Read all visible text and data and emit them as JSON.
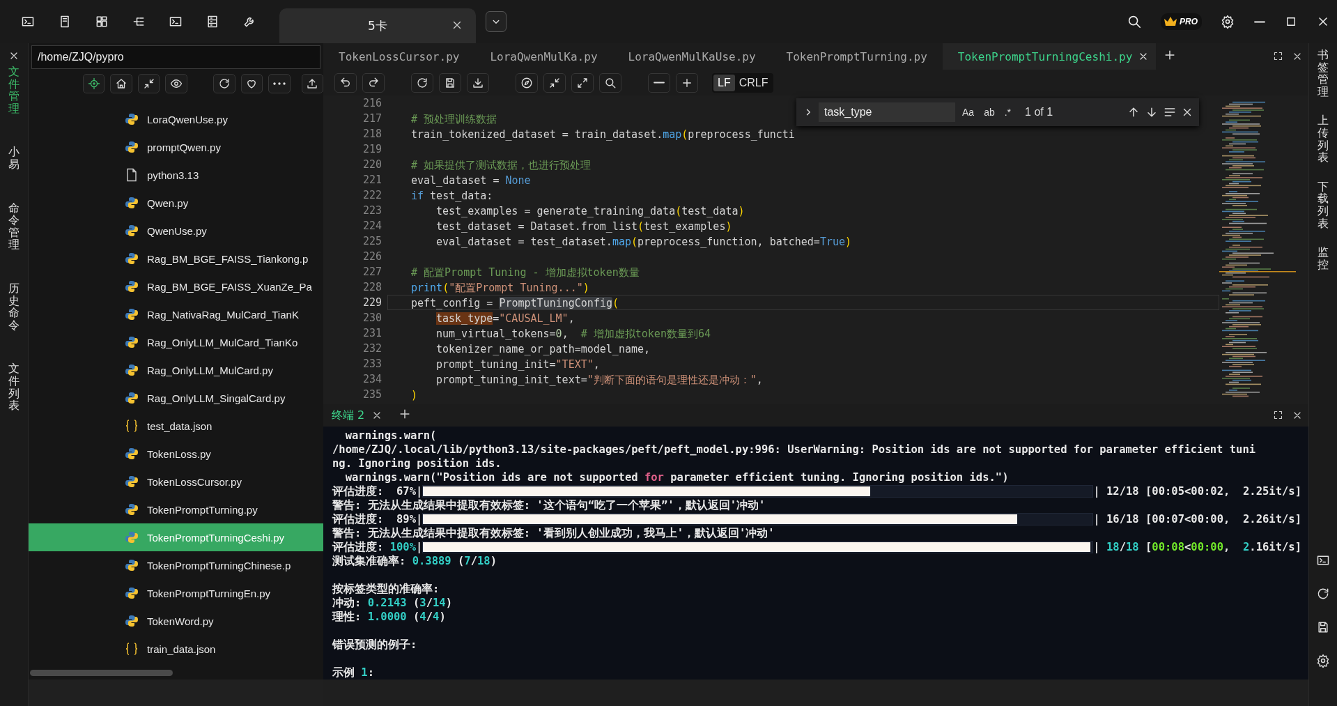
{
  "title_bar": {
    "tab": "5卡",
    "badge": "PRO"
  },
  "left_rail": {
    "items": [
      {
        "label": "文件管理",
        "selected": true
      },
      {
        "label": "小易",
        "selected": false
      },
      {
        "label": "命令管理",
        "selected": false
      },
      {
        "label": "历史命令",
        "selected": false
      },
      {
        "label": "文件列表",
        "selected": false
      }
    ]
  },
  "file_panel": {
    "path": "/home/ZJQ/pypro",
    "files": [
      {
        "name": "LoraQwenUse.py",
        "kind": "python",
        "selected": false
      },
      {
        "name": "promptQwen.py",
        "kind": "python",
        "selected": false
      },
      {
        "name": "python3.13",
        "kind": "file",
        "selected": false
      },
      {
        "name": "Qwen.py",
        "kind": "python",
        "selected": false
      },
      {
        "name": "QwenUse.py",
        "kind": "python",
        "selected": false
      },
      {
        "name": "Rag_BM_BGE_FAISS_Tiankong.p",
        "kind": "python",
        "selected": false
      },
      {
        "name": "Rag_BM_BGE_FAISS_XuanZe_Pa",
        "kind": "python",
        "selected": false
      },
      {
        "name": "Rag_NativaRag_MulCard_TianK",
        "kind": "python",
        "selected": false
      },
      {
        "name": "Rag_OnlyLLM_MulCard_TianKo",
        "kind": "python",
        "selected": false
      },
      {
        "name": "Rag_OnlyLLM_MulCard.py",
        "kind": "python",
        "selected": false
      },
      {
        "name": "Rag_OnlyLLM_SingalCard.py",
        "kind": "python",
        "selected": false
      },
      {
        "name": "test_data.json",
        "kind": "json",
        "selected": false
      },
      {
        "name": "TokenLoss.py",
        "kind": "python",
        "selected": false
      },
      {
        "name": "TokenLossCursor.py",
        "kind": "python",
        "selected": false
      },
      {
        "name": "TokenPromptTurning.py",
        "kind": "python",
        "selected": false
      },
      {
        "name": "TokenPromptTurningCeshi.py",
        "kind": "python",
        "selected": true
      },
      {
        "name": "TokenPromptTurningChinese.p",
        "kind": "python",
        "selected": false
      },
      {
        "name": "TokenPromptTurningEn.py",
        "kind": "python",
        "selected": false
      },
      {
        "name": "TokenWord.py",
        "kind": "python",
        "selected": false
      },
      {
        "name": "train_data.json",
        "kind": "json",
        "selected": false
      }
    ]
  },
  "editor": {
    "tabs": [
      {
        "label": "TokenLossCursor.py",
        "selected": false
      },
      {
        "label": "LoraQwenMulKa.py",
        "selected": false
      },
      {
        "label": "LoraQwenMulKaUse.py",
        "selected": false
      },
      {
        "label": "TokenPromptTurning.py",
        "selected": false
      },
      {
        "label": "TokenPromptTurningCeshi.py",
        "selected": true
      }
    ],
    "line_endings": [
      {
        "label": "LF",
        "selected": true
      },
      {
        "label": "CRLF",
        "selected": false
      }
    ],
    "find": {
      "value": "task_type",
      "options": [
        {
          "label": "Aa",
          "selected": false
        },
        {
          "label": "ab",
          "selected": false
        },
        {
          "label": ".*",
          "selected": false
        }
      ],
      "count": "1 of 1"
    },
    "lines": [
      {
        "number": "216",
        "current": false
      },
      {
        "number": "217",
        "current": false,
        "segments": [
          {
            "text": "# 预处理训练数据",
            "kind": "comment"
          }
        ]
      },
      {
        "number": "218",
        "current": false,
        "segments": [
          {
            "text": "train_tokenized_dataset = train_dataset.",
            "kind": "plain"
          },
          {
            "text": "map",
            "kind": "func"
          },
          {
            "text": "(",
            "kind": "paren"
          },
          {
            "text": "preprocess_functi",
            "kind": "plain"
          }
        ]
      },
      {
        "number": "219",
        "current": false
      },
      {
        "number": "220",
        "current": false,
        "segments": [
          {
            "text": "# 如果提供了测试数据，也进行预处理",
            "kind": "comment"
          }
        ]
      },
      {
        "number": "221",
        "current": false,
        "segments": [
          {
            "text": "eval_dataset = ",
            "kind": "plain"
          },
          {
            "text": "None",
            "kind": "keyword"
          }
        ]
      },
      {
        "number": "222",
        "current": false,
        "segments": [
          {
            "text": "if",
            "kind": "keyword"
          },
          {
            "text": " test_data:",
            "kind": "plain"
          }
        ],
        "children": [
          {
            "number": "223",
            "current": false,
            "segments": [
              {
                "text": "test_examples = generate_training_data",
                "kind": "plain"
              },
              {
                "text": "(",
                "kind": "paren"
              },
              {
                "text": "test_data",
                "kind": "plain"
              },
              {
                "text": ")",
                "kind": "paren"
              }
            ]
          },
          {
            "number": "224",
            "current": false,
            "segments": [
              {
                "text": "test_dataset = Dataset.from_list",
                "kind": "plain"
              },
              {
                "text": "(",
                "kind": "paren"
              },
              {
                "text": "test_examples",
                "kind": "plain"
              },
              {
                "text": ")",
                "kind": "paren"
              }
            ]
          },
          {
            "number": "225",
            "current": false,
            "segments": [
              {
                "text": "eval_dataset = test_dataset.",
                "kind": "plain"
              },
              {
                "text": "map",
                "kind": "func"
              },
              {
                "text": "(",
                "kind": "paren"
              },
              {
                "text": "preprocess_function, batched=",
                "kind": "plain"
              },
              {
                "text": "True",
                "kind": "keyword"
              },
              {
                "text": ")",
                "kind": "paren"
              }
            ]
          }
        ]
      },
      {
        "number": "226",
        "current": false
      },
      {
        "number": "227",
        "current": false,
        "segments": [
          {
            "text": "# 配置Prompt Tuning - 增加虚拟token数量",
            "kind": "comment"
          }
        ]
      },
      {
        "number": "228",
        "current": false,
        "segments": [
          {
            "text": "print",
            "kind": "func"
          },
          {
            "text": "(",
            "kind": "paren"
          },
          {
            "text": "\"配置Prompt Tuning...\"",
            "kind": "string"
          },
          {
            "text": ")",
            "kind": "paren"
          }
        ]
      },
      {
        "number": "229",
        "current": true,
        "segments": [
          {
            "text": "peft_config = ",
            "kind": "plain"
          },
          {
            "text": "PromptTuningConfig",
            "kind": "hover"
          },
          {
            "text": "(",
            "kind": "paren"
          }
        ],
        "children": [
          {
            "number": "230",
            "current": false,
            "segments": [
              {
                "text": "task_type",
                "kind": "match"
              },
              {
                "text": "=",
                "kind": "plain"
              },
              {
                "text": "\"CAUSAL_LM\"",
                "kind": "string"
              },
              {
                "text": ",",
                "kind": "plain"
              }
            ]
          },
          {
            "number": "231",
            "current": false,
            "segments": [
              {
                "text": "num_virtual_tokens=",
                "kind": "plain"
              },
              {
                "text": "0",
                "kind": "number"
              },
              {
                "text": ",  ",
                "kind": "plain"
              },
              {
                "text": "# 增加虚拟token数量到64",
                "kind": "comment"
              }
            ]
          },
          {
            "number": "232",
            "current": false,
            "segments": [
              {
                "text": "tokenizer_name_or_path=model_name,",
                "kind": "plain"
              }
            ]
          },
          {
            "number": "233",
            "current": false,
            "segments": [
              {
                "text": "prompt_tuning_init=",
                "kind": "plain"
              },
              {
                "text": "\"TEXT\"",
                "kind": "string"
              },
              {
                "text": ",",
                "kind": "plain"
              }
            ]
          },
          {
            "number": "234",
            "current": false,
            "segments": [
              {
                "text": "prompt_tuning_init_text=",
                "kind": "plain"
              },
              {
                "text": "\"判断下面的语句是理性还是冲动：\"",
                "kind": "string"
              },
              {
                "text": ",",
                "kind": "plain"
              }
            ]
          }
        ]
      },
      {
        "number": "235",
        "current": false,
        "segments": [
          {
            "text": ")",
            "kind": "paren"
          }
        ]
      }
    ]
  },
  "terminal": {
    "tab": "终端 2",
    "lines": [
      {
        "kind": "text",
        "segments": [
          {
            "text": "  warnings.warn(",
            "kind": "plain"
          }
        ]
      },
      {
        "kind": "text",
        "segments": [
          {
            "text": "/home/ZJQ/.local/lib/python3.13/site-packages/peft/peft_model.py:996: UserWarning: Position ids are not supported for parameter efficient tuni",
            "kind": "plain"
          }
        ]
      },
      {
        "kind": "text",
        "segments": [
          {
            "text": "ng. Ignoring position ids.",
            "kind": "plain"
          }
        ]
      },
      {
        "kind": "text",
        "segments": [
          {
            "text": "  warnings.warn(\"Position ids are not supported ",
            "kind": "plain"
          },
          {
            "text": "for",
            "kind": "keyword"
          },
          {
            "text": " parameter efficient tuning. Ignoring position ids.\")",
            "kind": "plain"
          }
        ]
      },
      {
        "kind": "progress",
        "prefix": [
          {
            "text": "评估进度:  67%|",
            "kind": "plain"
          }
        ],
        "level": 0.67,
        "suffix": [
          {
            "text": "| 12/18 [00:05<00:02,  2.25it/s]",
            "kind": "plain"
          }
        ]
      },
      {
        "kind": "text",
        "segments": [
          {
            "text": "警告: 无法从生成结果中提取有效标签: '这个语句“吃了一个苹果”'，默认返回'冲动'",
            "kind": "plain"
          }
        ]
      },
      {
        "kind": "progress",
        "prefix": [
          {
            "text": "评估进度:  89%|",
            "kind": "plain"
          }
        ],
        "level": 0.89,
        "suffix": [
          {
            "text": "| 16/18 [00:07<00:00,  2.26it/s]",
            "kind": "plain"
          }
        ]
      },
      {
        "kind": "text",
        "segments": [
          {
            "text": "警告: 无法从生成结果中提取有效标签: '看到别人创业成功，我马上'，默认返回'冲动'",
            "kind": "plain"
          }
        ]
      },
      {
        "kind": "progress",
        "prefix": [
          {
            "text": "评估进度: ",
            "kind": "plain"
          },
          {
            "text": "100%",
            "kind": "num"
          },
          {
            "text": "|",
            "kind": "plain"
          }
        ],
        "level": 1,
        "suffix": [
          {
            "text": "| ",
            "kind": "plain"
          },
          {
            "text": "18",
            "kind": "num"
          },
          {
            "text": "/",
            "kind": "plain"
          },
          {
            "text": "18",
            "kind": "num"
          },
          {
            "text": " [",
            "kind": "plain"
          },
          {
            "text": "00:08",
            "kind": "time"
          },
          {
            "text": "<",
            "kind": "plain"
          },
          {
            "text": "00:00",
            "kind": "time"
          },
          {
            "text": ",  ",
            "kind": "plain"
          },
          {
            "text": "2",
            "kind": "num"
          },
          {
            "text": ".16it/s]",
            "kind": "plain"
          }
        ]
      },
      {
        "kind": "text",
        "segments": [
          {
            "text": "测试集准确率: ",
            "kind": "plain"
          },
          {
            "text": "0.3889",
            "kind": "num"
          },
          {
            "text": " (",
            "kind": "plain"
          },
          {
            "text": "7",
            "kind": "num"
          },
          {
            "text": "/",
            "kind": "plain"
          },
          {
            "text": "18",
            "kind": "num"
          },
          {
            "text": ")",
            "kind": "plain"
          }
        ]
      },
      {
        "kind": "blank"
      },
      {
        "kind": "text",
        "segments": [
          {
            "text": "按标签类型的准确率:",
            "kind": "plain"
          }
        ]
      },
      {
        "kind": "text",
        "segments": [
          {
            "text": "冲动: ",
            "kind": "plain"
          },
          {
            "text": "0.2143",
            "kind": "num"
          },
          {
            "text": " (",
            "kind": "plain"
          },
          {
            "text": "3",
            "kind": "num"
          },
          {
            "text": "/",
            "kind": "plain"
          },
          {
            "text": "14",
            "kind": "num"
          },
          {
            "text": ")",
            "kind": "plain"
          }
        ]
      },
      {
        "kind": "text",
        "segments": [
          {
            "text": "理性: ",
            "kind": "plain"
          },
          {
            "text": "1.0000",
            "kind": "num"
          },
          {
            "text": " (",
            "kind": "plain"
          },
          {
            "text": "4",
            "kind": "num"
          },
          {
            "text": "/",
            "kind": "plain"
          },
          {
            "text": "4",
            "kind": "num"
          },
          {
            "text": ")",
            "kind": "plain"
          }
        ]
      },
      {
        "kind": "blank"
      },
      {
        "kind": "text",
        "segments": [
          {
            "text": "错误预测的例子:",
            "kind": "plain"
          }
        ]
      },
      {
        "kind": "blank"
      },
      {
        "kind": "text",
        "segments": [
          {
            "text": "示例 ",
            "kind": "plain"
          },
          {
            "text": "1",
            "kind": "num"
          },
          {
            "text": ":",
            "kind": "plain"
          }
        ]
      }
    ]
  },
  "right_rail": {
    "items": [
      {
        "label": "书签管理",
        "selected": false
      },
      {
        "label": "上传列表",
        "selected": false
      },
      {
        "label": "下载列表",
        "selected": false
      },
      {
        "label": "监控",
        "selected": false
      }
    ]
  }
}
